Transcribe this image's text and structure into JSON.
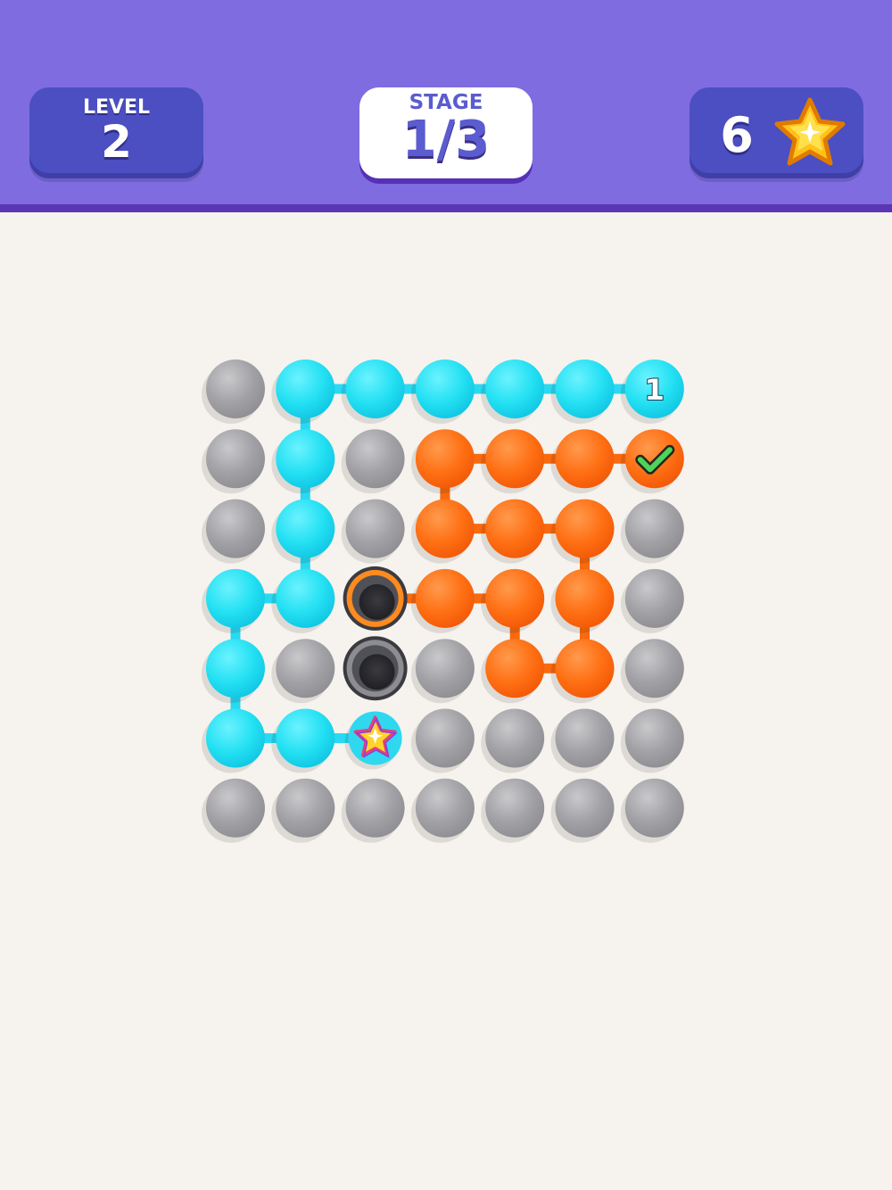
{
  "hud": {
    "level_label": "LEVEL",
    "level_value": "2",
    "stage_label": "STAGE",
    "stage_value": "1/3",
    "stars_count": "6",
    "stars_icon": "star-icon"
  },
  "colors": {
    "header": "#7e6ce0",
    "header_border": "#5a36b4",
    "hud_dark": "#4b4fc1",
    "background": "#f6f3ee",
    "cyan": "#23e2f2",
    "orange": "#ff6f17",
    "gray": "#a1a1a5",
    "star": "#ffc21a"
  },
  "board": {
    "rows": 7,
    "cols": 7,
    "cells": [
      [
        "gray",
        "cyan",
        "cyan",
        "cyan",
        "cyan",
        "cyan",
        "cyan"
      ],
      [
        "gray",
        "cyan",
        "gray",
        "orange",
        "orange",
        "orange",
        "orange"
      ],
      [
        "gray",
        "cyan",
        "gray",
        "orange",
        "orange",
        "orange",
        "gray"
      ],
      [
        "cyan",
        "cyan",
        "hole-orange",
        "orange",
        "orange",
        "orange",
        "gray"
      ],
      [
        "cyan",
        "gray",
        "hole-gray",
        "gray",
        "orange",
        "orange",
        "gray"
      ],
      [
        "cyan",
        "cyan",
        "star",
        "gray",
        "gray",
        "gray",
        "gray"
      ],
      [
        "gray",
        "gray",
        "gray",
        "gray",
        "gray",
        "gray",
        "gray"
      ]
    ],
    "cyan_links": [
      [
        [
          0,
          1
        ],
        [
          0,
          2
        ]
      ],
      [
        [
          0,
          2
        ],
        [
          0,
          3
        ]
      ],
      [
        [
          0,
          3
        ],
        [
          0,
          4
        ]
      ],
      [
        [
          0,
          4
        ],
        [
          0,
          5
        ]
      ],
      [
        [
          0,
          5
        ],
        [
          0,
          6
        ]
      ],
      [
        [
          0,
          1
        ],
        [
          1,
          1
        ]
      ],
      [
        [
          1,
          1
        ],
        [
          2,
          1
        ]
      ],
      [
        [
          2,
          1
        ],
        [
          3,
          1
        ]
      ],
      [
        [
          3,
          0
        ],
        [
          3,
          1
        ]
      ],
      [
        [
          3,
          0
        ],
        [
          4,
          0
        ]
      ],
      [
        [
          4,
          0
        ],
        [
          5,
          0
        ]
      ],
      [
        [
          5,
          0
        ],
        [
          5,
          1
        ]
      ],
      [
        [
          5,
          1
        ],
        [
          5,
          2
        ]
      ]
    ],
    "orange_links": [
      [
        [
          1,
          3
        ],
        [
          1,
          4
        ]
      ],
      [
        [
          1,
          4
        ],
        [
          1,
          5
        ]
      ],
      [
        [
          1,
          5
        ],
        [
          1,
          6
        ]
      ],
      [
        [
          1,
          3
        ],
        [
          2,
          3
        ]
      ],
      [
        [
          2,
          3
        ],
        [
          2,
          4
        ]
      ],
      [
        [
          2,
          4
        ],
        [
          2,
          5
        ]
      ],
      [
        [
          2,
          5
        ],
        [
          3,
          5
        ]
      ],
      [
        [
          3,
          2
        ],
        [
          3,
          3
        ]
      ],
      [
        [
          3,
          3
        ],
        [
          3,
          4
        ]
      ],
      [
        [
          3,
          4
        ],
        [
          4,
          4
        ]
      ],
      [
        [
          3,
          5
        ],
        [
          4,
          5
        ]
      ],
      [
        [
          4,
          4
        ],
        [
          4,
          5
        ]
      ]
    ],
    "badges": [
      {
        "row": 0,
        "col": 6,
        "type": "text",
        "text": "1"
      },
      {
        "row": 1,
        "col": 6,
        "type": "check-icon"
      }
    ]
  }
}
